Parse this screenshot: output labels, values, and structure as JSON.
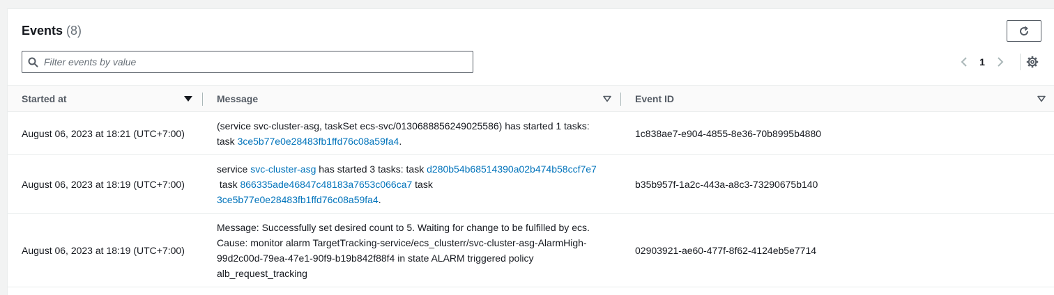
{
  "header": {
    "title": "Events",
    "count": "(8)"
  },
  "search": {
    "placeholder": "Filter events by value",
    "value": ""
  },
  "pagination": {
    "current_page": "1"
  },
  "table": {
    "columns": [
      "Started at",
      "Message",
      "Event ID"
    ],
    "rows": [
      {
        "started_at": "August 06, 2023 at 18:21 (UTC+7:00)",
        "message": [
          {
            "text": "(service svc-cluster-asg, taskSet ecs-svc/0130688856249025586) has started 1 tasks:"
          },
          {
            "text": "task "
          },
          {
            "link": "3ce5b77e0e28483fb1ffd76c08a59fa4"
          },
          {
            "text": "."
          }
        ],
        "event_id": "1c838ae7-e904-4855-8e36-70b8995b4880"
      },
      {
        "started_at": "August 06, 2023 at 18:19 (UTC+7:00)",
        "message": [
          {
            "text": "service "
          },
          {
            "link": "svc-cluster-asg"
          },
          {
            "text": " has started 3 tasks: task "
          },
          {
            "link": "d280b54b68514390a02b474b58ccf7e7"
          },
          {
            "text": " task "
          },
          {
            "link": "866335ade46847c48183a7653c066ca7"
          },
          {
            "text": " task "
          },
          {
            "link": "3ce5b77e0e28483fb1ffd76c08a59fa4"
          },
          {
            "text": "."
          }
        ],
        "event_id": "b35b957f-1a2c-443a-a8c3-73290675b140"
      },
      {
        "started_at": "August 06, 2023 at 18:19 (UTC+7:00)",
        "message": [
          {
            "text": "Message: Successfully set desired count to 5. Waiting for change to be fulfilled by ecs. Cause: monitor alarm TargetTracking-service/ecs_clusterr/svc-cluster-asg-AlarmHigh-99d2c00d-79ea-47e1-90f9-b19b842f88f4 in state ALARM triggered policy alb_request_tracking"
          }
        ],
        "event_id": "02903921-ae60-477f-8f62-4124eb5e7714"
      }
    ]
  },
  "icons": {
    "refresh": "refresh-icon",
    "search": "search-icon",
    "prev": "chevron-left-icon",
    "next": "chevron-right-icon",
    "settings": "gear-icon",
    "sort": "caret-down-icon"
  },
  "colors": {
    "link": "#0073bb",
    "text": "#16191f",
    "muted": "#687078"
  }
}
